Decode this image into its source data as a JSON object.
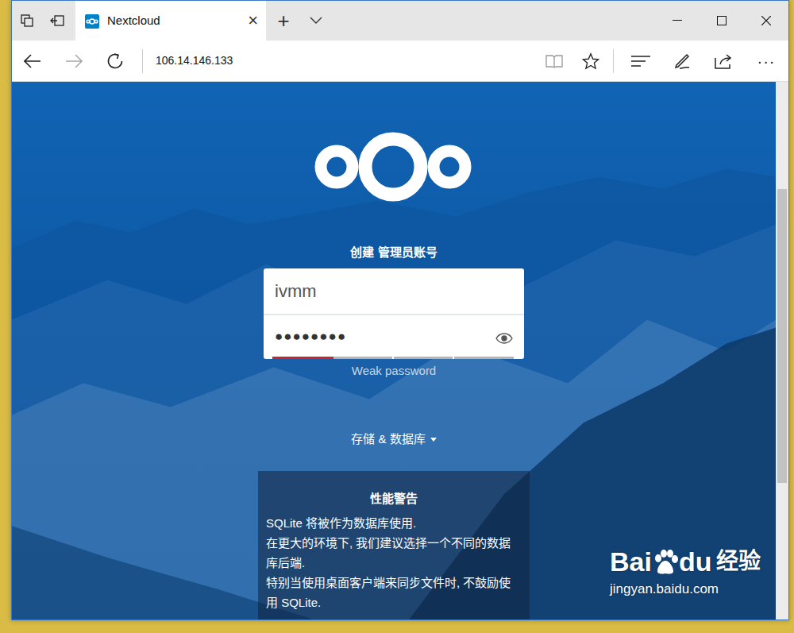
{
  "window": {
    "title": "Nextcloud"
  },
  "tabs": [
    {
      "label": "Nextcloud",
      "selected": true,
      "close": "×"
    }
  ],
  "new_tab": "+",
  "address_bar": {
    "url": "106.14.146.133"
  },
  "more_menu": "···",
  "page": {
    "heading": "创建 管理员账号",
    "username": "ivmm",
    "password": {
      "mask": "●●●●●●●●",
      "level": 0.25,
      "strength_label": "Weak password"
    },
    "storage_toggle": {
      "label": "存储 & 数据库",
      "expanded": false
    },
    "warning": {
      "title": "性能警告",
      "lines": [
        "SQLite 将被作为数据库使用.",
        "在更大的环境下, 我们建议选择一个不同的数据库后端.",
        "特别当使用桌面客户端来同步文件时, 不鼓励使用 SQLite."
      ]
    }
  },
  "watermark": {
    "brand_a": "Bai",
    "brand_b": "du",
    "brand_cn": "经验",
    "url": "jingyan.baidu.com"
  }
}
